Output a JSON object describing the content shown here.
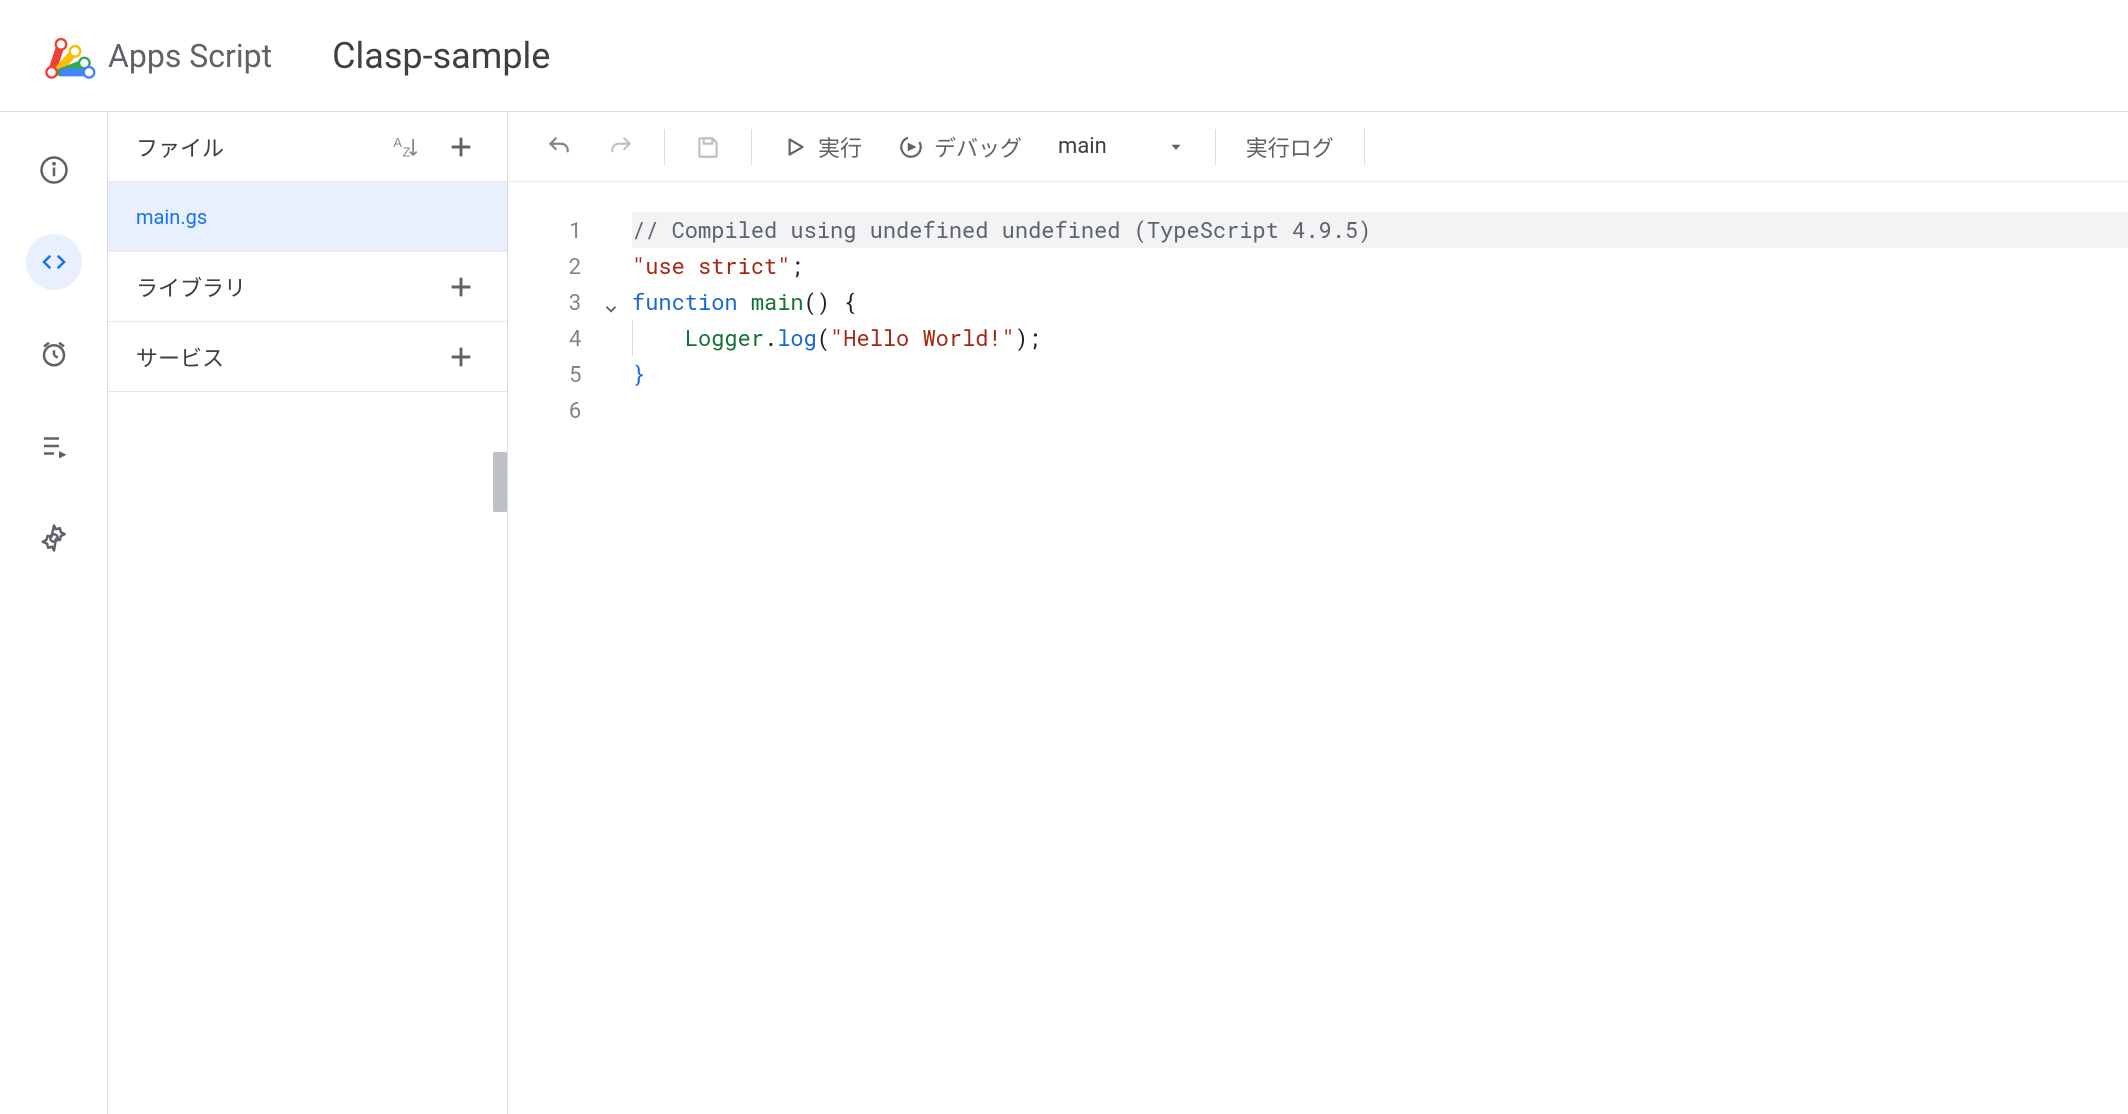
{
  "header": {
    "product_name": "Apps Script",
    "project_name": "Clasp-sample"
  },
  "file_panel": {
    "files_label": "ファイル",
    "libraries_label": "ライブラリ",
    "services_label": "サービス",
    "files": [
      {
        "name": "main.gs",
        "selected": true
      }
    ]
  },
  "toolbar": {
    "run_label": "実行",
    "debug_label": "デバッグ",
    "function_selected": "main",
    "log_label": "実行ログ"
  },
  "editor": {
    "lines": [
      {
        "n": 1,
        "type": "comment",
        "text": "// Compiled using undefined undefined (TypeScript 4.9.5)",
        "hl": true
      },
      {
        "n": 2,
        "type": "use_strict",
        "string": "\"use strict\"",
        "punct": ";"
      },
      {
        "n": 3,
        "type": "fn_decl",
        "kw": "function",
        "name": "main",
        "parens": "()",
        "brace": " {",
        "fold": true
      },
      {
        "n": 4,
        "type": "call",
        "indent": 1,
        "cls": "Logger",
        "dot": ".",
        "method": "log",
        "open": "(",
        "arg": "\"Hello World!\"",
        "close": ")",
        "semi": ";"
      },
      {
        "n": 5,
        "type": "close_brace",
        "brace": "}"
      },
      {
        "n": 6,
        "type": "empty"
      }
    ]
  }
}
